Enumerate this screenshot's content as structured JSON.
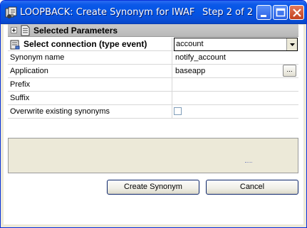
{
  "window": {
    "title": "LOOPBACK: Create Synonym for IWAF",
    "step": "Step 2 of 2"
  },
  "grid": {
    "section_title": "Selected Parameters",
    "connection": {
      "label": "Select connection (type event)",
      "value": "account"
    },
    "rows": [
      {
        "label": "Synonym name",
        "value": "notify_account"
      },
      {
        "label": "Application",
        "value": "baseapp",
        "browse": "..."
      },
      {
        "label": "Prefix",
        "value": ""
      },
      {
        "label": "Suffix",
        "value": ""
      },
      {
        "label": "Overwrite existing synonyms",
        "checked": false
      }
    ]
  },
  "buttons": {
    "create": "Create Synonym",
    "cancel": "Cancel"
  },
  "colors": {
    "title_bar": "#0454e3",
    "dialog_bg": "#ece9d8",
    "grid_header": "#c0c0c0"
  }
}
